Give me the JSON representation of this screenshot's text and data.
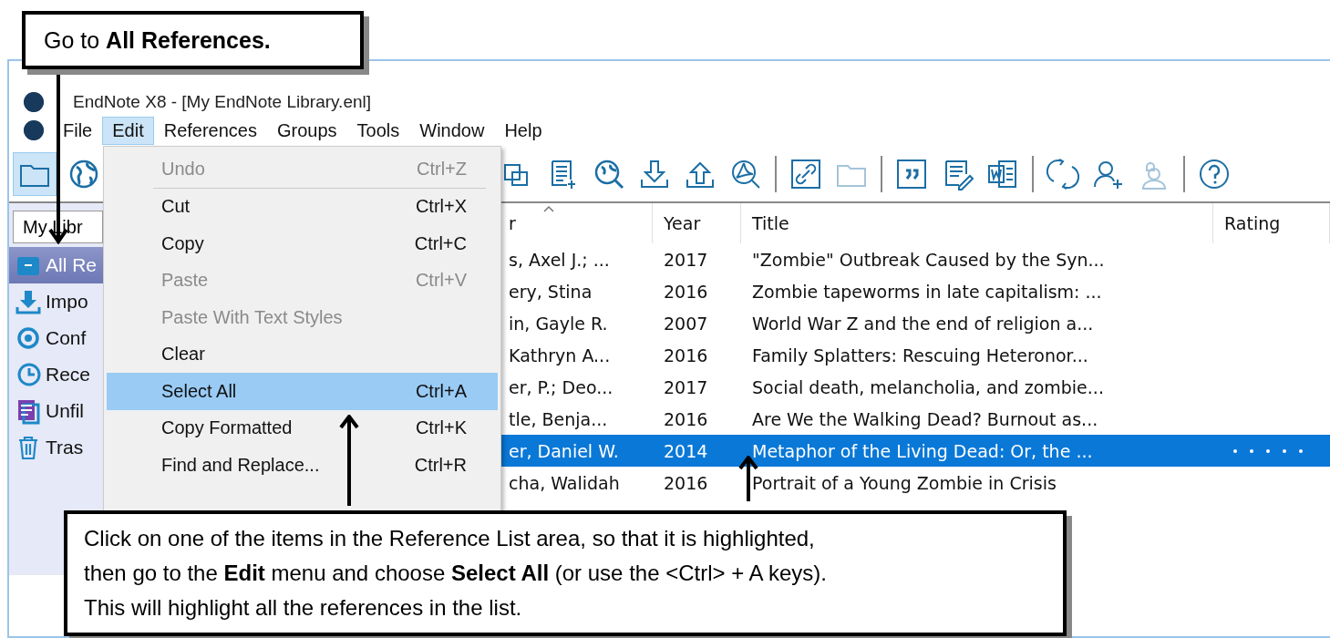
{
  "window": {
    "title": "EndNote X8 - [My EndNote Library.enl]"
  },
  "menu_bar": [
    {
      "label": "File",
      "selected": false
    },
    {
      "label": "Edit",
      "selected": true
    },
    {
      "label": "References",
      "selected": false
    },
    {
      "label": "Groups",
      "selected": false
    },
    {
      "label": "Tools",
      "selected": false
    },
    {
      "label": "Window",
      "selected": false
    },
    {
      "label": "Help",
      "selected": false
    }
  ],
  "toolbar": {
    "left": [
      {
        "kind": "folder",
        "selected": true
      },
      {
        "kind": "globe",
        "selected": false
      }
    ],
    "right": [
      {
        "kind": "copy",
        "disabled": false
      },
      {
        "kind": "newref",
        "disabled": false
      },
      {
        "kind": "globesearch",
        "disabled": false
      },
      {
        "kind": "download",
        "disabled": false
      },
      {
        "kind": "upload",
        "disabled": false
      },
      {
        "kind": "pdfsearch",
        "disabled": false
      },
      {
        "kind": "sep"
      },
      {
        "kind": "link",
        "disabled": false
      },
      {
        "kind": "folder",
        "disabled": true
      },
      {
        "kind": "sep"
      },
      {
        "kind": "quote",
        "disabled": false
      },
      {
        "kind": "editdoc",
        "disabled": false
      },
      {
        "kind": "word",
        "disabled": false
      },
      {
        "kind": "sep"
      },
      {
        "kind": "sync",
        "disabled": false
      },
      {
        "kind": "useradd",
        "disabled": false
      },
      {
        "kind": "share",
        "disabled": true
      },
      {
        "kind": "sep"
      },
      {
        "kind": "help",
        "disabled": false
      }
    ]
  },
  "library_selector": {
    "value": "My Libr"
  },
  "sidebar": {
    "items": [
      {
        "label": "All Re",
        "kind": "all",
        "selected": true
      },
      {
        "label": "Impo",
        "kind": "import",
        "selected": false
      },
      {
        "label": "Conf",
        "kind": "sync",
        "selected": false
      },
      {
        "label": "Rece",
        "kind": "recent",
        "selected": false
      },
      {
        "label": "Unfil",
        "kind": "unfiled",
        "selected": false
      },
      {
        "label": "Tras",
        "kind": "trash",
        "selected": false
      }
    ]
  },
  "table": {
    "columns": [
      "r",
      "Year",
      "Title",
      "Rating"
    ],
    "rows": [
      {
        "cells": [
          "s, Axel J.; ...",
          "2017",
          "\"Zombie\" Outbreak Caused by the Syn..."
        ],
        "selected": false
      },
      {
        "cells": [
          "ery, Stina",
          "2016",
          "Zombie tapeworms in late capitalism: ..."
        ],
        "selected": false
      },
      {
        "cells": [
          "in, Gayle R.",
          "2007",
          "World War Z and the end of religion a..."
        ],
        "selected": false
      },
      {
        "cells": [
          " Kathryn A...",
          "2016",
          "Family Splatters: Rescuing Heteronor..."
        ],
        "selected": false
      },
      {
        "cells": [
          "er, P.; Deo...",
          "2017",
          "Social death, melancholia, and zombie..."
        ],
        "selected": false
      },
      {
        "cells": [
          "tle, Benja...",
          "2016",
          "Are We the Walking Dead? Burnout as..."
        ],
        "selected": false
      },
      {
        "cells": [
          "er, Daniel W.",
          "2014",
          "Metaphor of the Living Dead: Or, the ..."
        ],
        "selected": true
      },
      {
        "cells": [
          "cha, Walidah",
          "2016",
          "Portrait of a Young Zombie in Crisis"
        ],
        "selected": false
      }
    ]
  },
  "edit_menu": [
    {
      "kind": "item",
      "label": "Undo",
      "shortcut": "Ctrl+Z",
      "disabled": true,
      "selected": false
    },
    {
      "kind": "separator"
    },
    {
      "kind": "item",
      "label": "Cut",
      "shortcut": "Ctrl+X",
      "disabled": false,
      "selected": false
    },
    {
      "kind": "item",
      "label": "Copy",
      "shortcut": "Ctrl+C",
      "disabled": false,
      "selected": false
    },
    {
      "kind": "item",
      "label": "Paste",
      "shortcut": "Ctrl+V",
      "disabled": true,
      "selected": false
    },
    {
      "kind": "item",
      "label": "Paste With Text Styles",
      "disabled": true,
      "selected": false
    },
    {
      "kind": "item",
      "label": "Clear",
      "disabled": false,
      "selected": false
    },
    {
      "kind": "item",
      "label": "Select All",
      "shortcut": "Ctrl+A",
      "disabled": false,
      "selected": true
    },
    {
      "kind": "item",
      "label": "Copy Formatted",
      "shortcut": "Ctrl+K",
      "disabled": false,
      "selected": false
    },
    {
      "kind": "item",
      "label": "Find and Replace...",
      "shortcut": "Ctrl+R",
      "disabled": false,
      "selected": false
    }
  ],
  "callouts": [
    {
      "text": "Go to  **All References.**"
    },
    {
      "text": "Click on one of the items in the Reference List area, so that it is highlighted,\nthen go to the **Edit** menu and choose **Select All** (or use the <Ctrl> + A keys).\nThis will highlight all the references in the list."
    }
  ]
}
